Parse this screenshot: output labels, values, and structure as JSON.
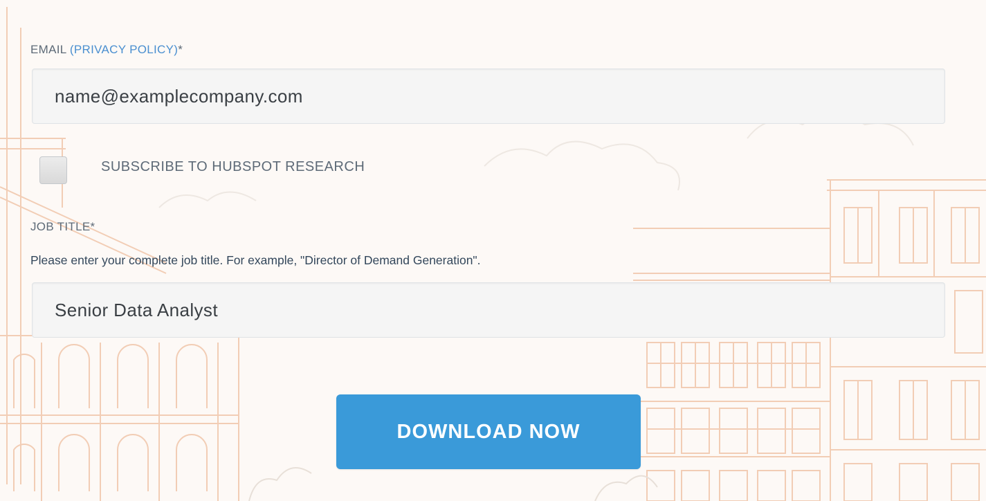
{
  "colors": {
    "background": "#fdf9f6",
    "illustration_line": "#f1c9ae",
    "link": "#4a8fd0",
    "label": "#5d6a77",
    "input_bg": "#f5f5f5",
    "button_bg": "#3a9ad9",
    "button_text": "#ffffff"
  },
  "form": {
    "email": {
      "label": "EMAIL",
      "link_label": "(PRIVACY POLICY)",
      "required_mark": "*",
      "value": "name@examplecompany.com"
    },
    "subscribe": {
      "label": "SUBSCRIBE TO HUBSPOT RESEARCH",
      "checked": false
    },
    "job_title": {
      "label": "JOB TITLE",
      "required_mark": "*",
      "help_text": "Please enter your complete job title. For example, \"Director of Demand Generation\".",
      "value": "Senior Data Analyst"
    },
    "submit": {
      "label": "DOWNLOAD NOW"
    }
  },
  "icons": {
    "background": "building-illustration"
  }
}
